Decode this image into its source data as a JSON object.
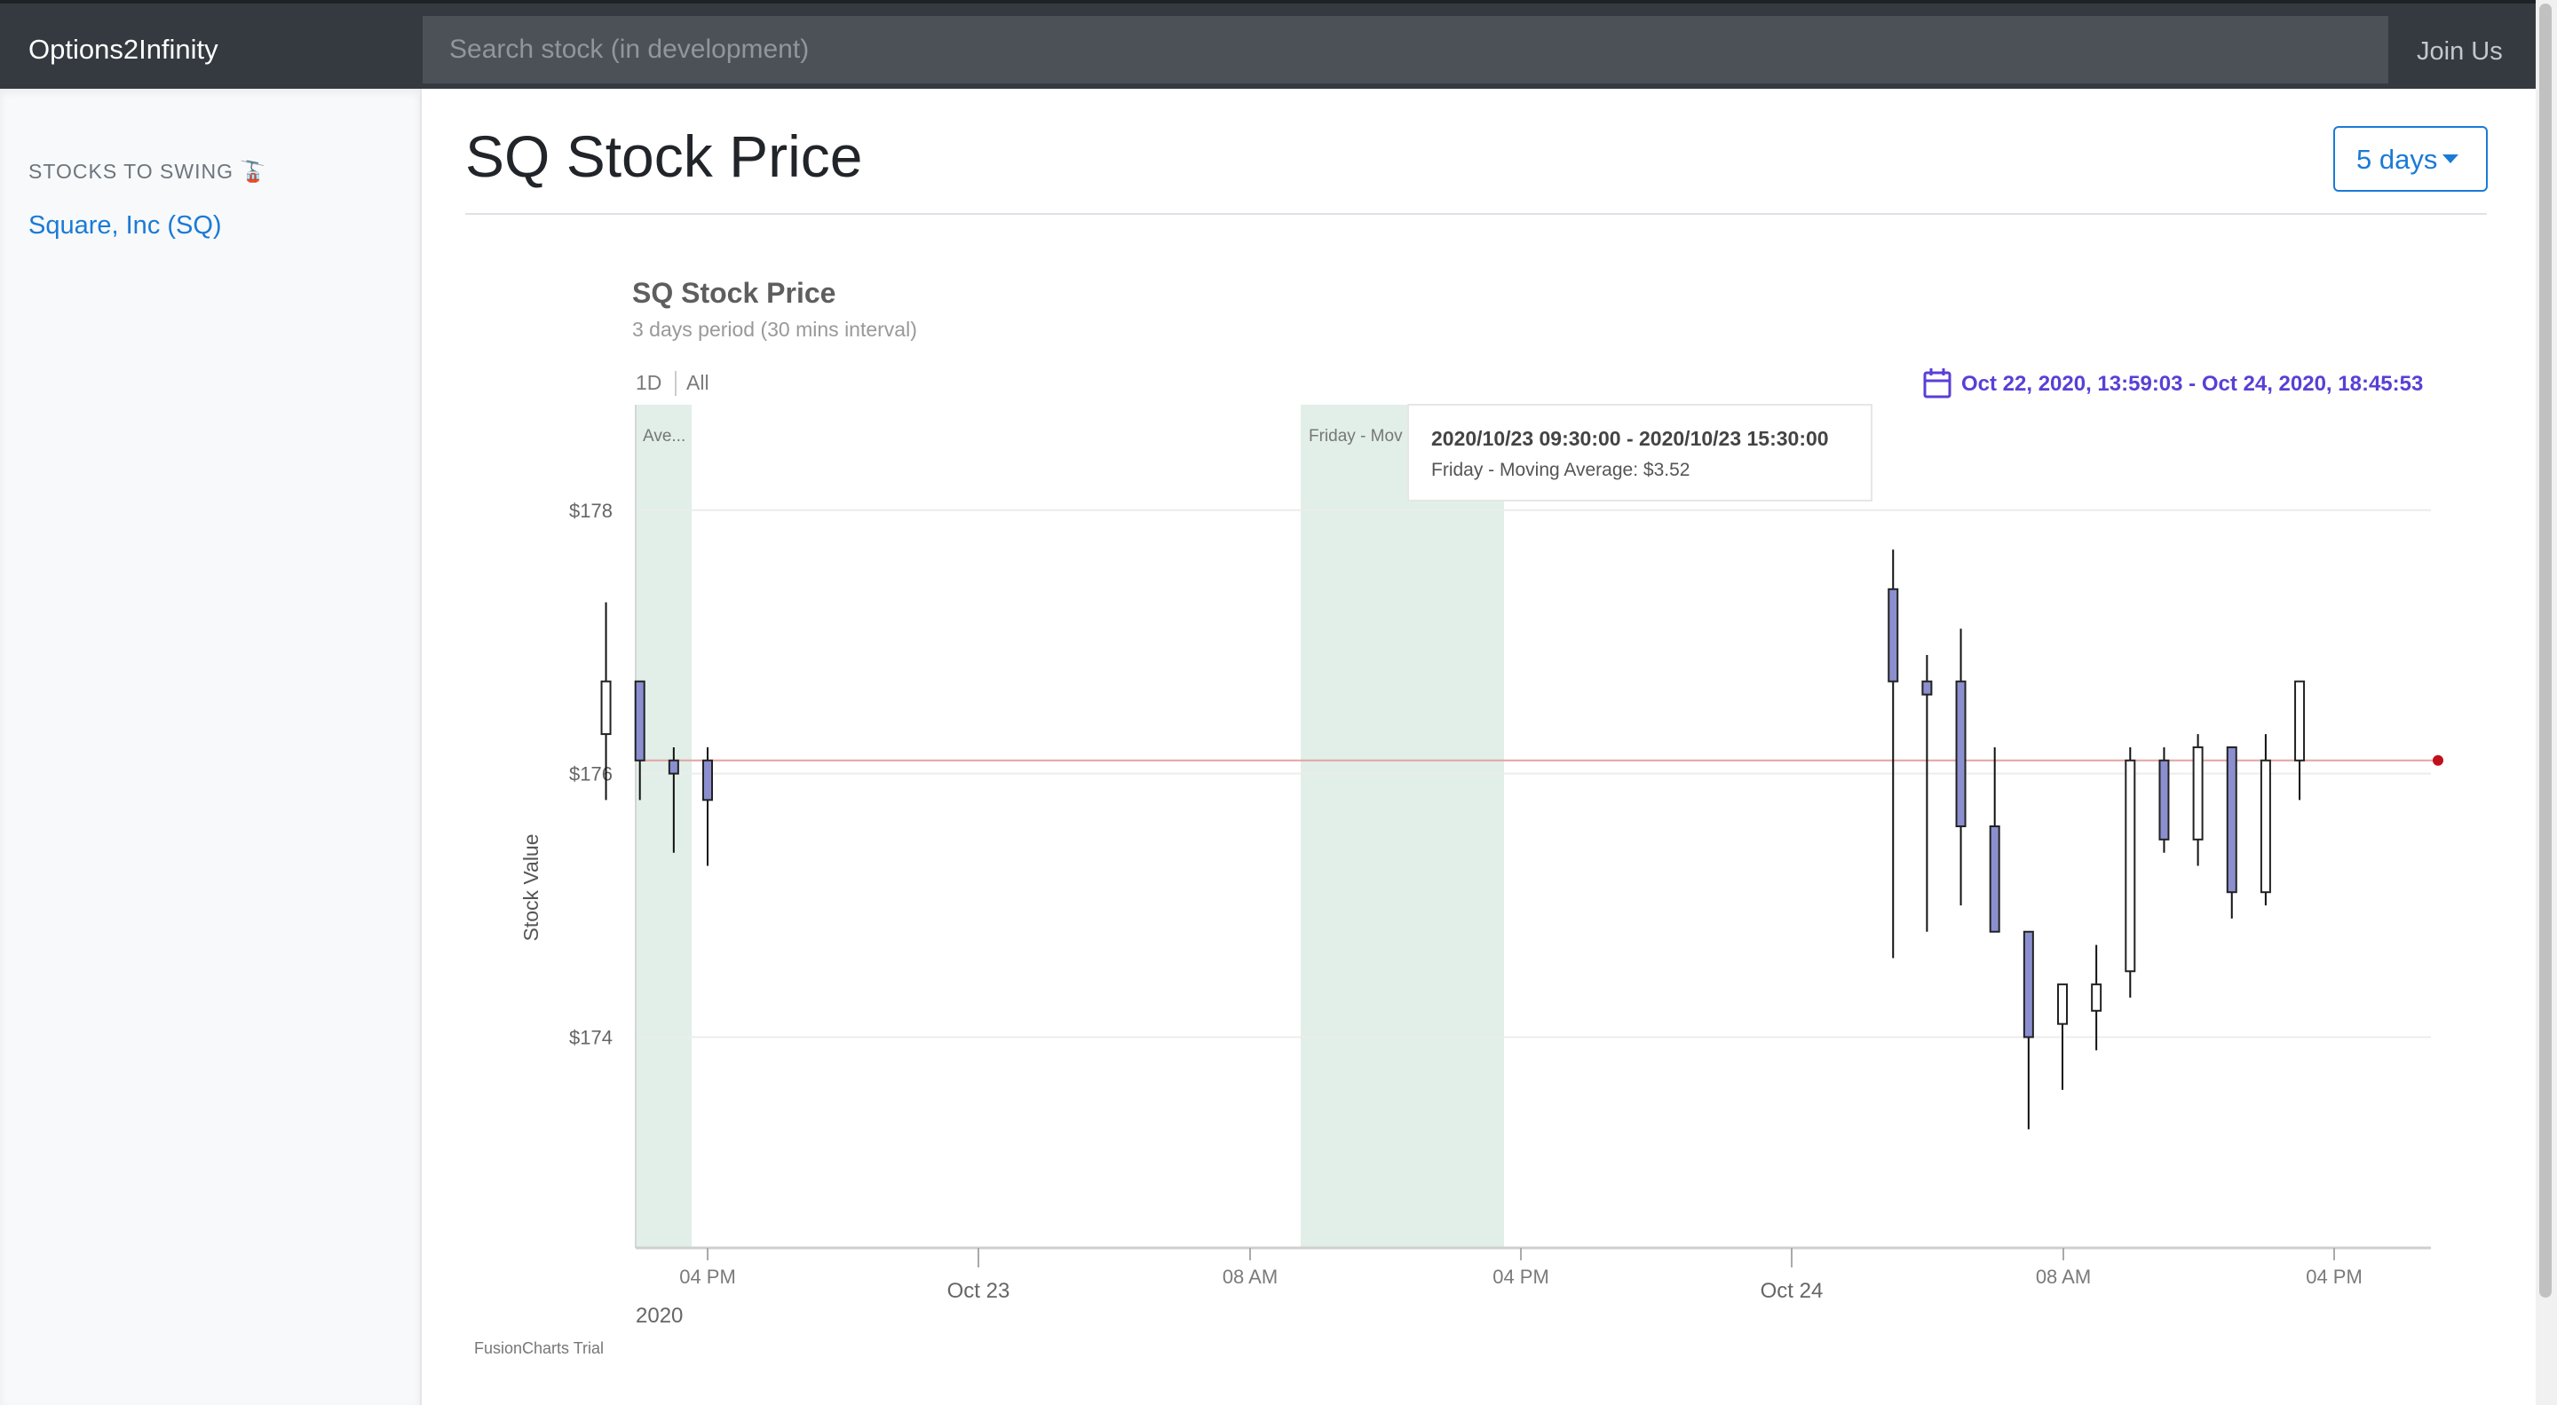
{
  "navbar": {
    "brand": "Options2Infinity",
    "search_placeholder": "Search stock (in development)",
    "join_label": "Join Us"
  },
  "sidebar": {
    "heading": "STOCKS TO SWING 🚡",
    "items": [
      {
        "label": "Square, Inc (SQ)"
      }
    ]
  },
  "main": {
    "title": "SQ Stock Price",
    "range_button": "5 days"
  },
  "chart": {
    "title": "SQ Stock Price",
    "subtitle": "3 days period (30 mins interval)",
    "period_buttons": [
      "1D",
      "All"
    ],
    "date_range": "Oct 22, 2020, 13:59:03 - Oct 24, 2020, 18:45:53",
    "ylabel": "Stock Value",
    "x_tick_labels": [
      "04 PM",
      "Oct 23",
      "08 AM",
      "04 PM",
      "Oct 24",
      "08 AM",
      "04 PM"
    ],
    "year_label": "2020",
    "band_labels": [
      "Ave...",
      "Friday - Mov"
    ],
    "tooltip": {
      "title": "2020/10/23 09:30:00 - 2020/10/23 15:30:00",
      "body": "Friday - Moving Average: $3.52"
    },
    "watermark": "FusionCharts Trial",
    "colors": {
      "down": "#8b8fd0",
      "up": "#ffffff",
      "band": "#e1efe8",
      "line": "#e2a3a3",
      "marker": "#c0111b",
      "accent": "#5a3fd6"
    }
  },
  "chart_data": {
    "type": "candlestick",
    "title": "SQ Stock Price",
    "subtitle": "3 days period (30 mins interval)",
    "ylabel": "Stock Value",
    "ylim": [
      172.4,
      178.8
    ],
    "y_ticks": [
      "$174",
      "$176",
      "$178"
    ],
    "y_tick_values": [
      174,
      176,
      178
    ],
    "reference_line": 176.1,
    "candles": [
      {
        "time": "2020-10-22 14:30",
        "open": 176.3,
        "high": 177.3,
        "low": 175.8,
        "close": 176.7
      },
      {
        "time": "2020-10-22 15:00",
        "open": 176.7,
        "high": 176.7,
        "low": 175.8,
        "close": 176.1
      },
      {
        "time": "2020-10-22 15:30",
        "open": 176.1,
        "high": 176.2,
        "low": 175.4,
        "close": 176.0
      },
      {
        "time": "2020-10-22 16:00",
        "open": 176.1,
        "high": 176.2,
        "low": 175.3,
        "close": 175.8
      },
      {
        "time": "2020-10-23 09:30",
        "open": 177.4,
        "high": 177.7,
        "low": 174.6,
        "close": 176.7
      },
      {
        "time": "2020-10-23 10:00",
        "open": 176.7,
        "high": 176.9,
        "low": 174.8,
        "close": 176.6
      },
      {
        "time": "2020-10-23 10:30",
        "open": 176.7,
        "high": 177.1,
        "low": 175.0,
        "close": 175.6
      },
      {
        "time": "2020-10-23 11:00",
        "open": 175.6,
        "high": 176.2,
        "low": 174.8,
        "close": 174.8
      },
      {
        "time": "2020-10-23 11:30",
        "open": 174.8,
        "high": 174.8,
        "low": 173.3,
        "close": 174.0
      },
      {
        "time": "2020-10-23 12:00",
        "open": 174.1,
        "high": 174.4,
        "low": 173.6,
        "close": 174.4
      },
      {
        "time": "2020-10-23 12:30",
        "open": 174.2,
        "high": 174.7,
        "low": 173.9,
        "close": 174.4
      },
      {
        "time": "2020-10-23 13:00",
        "open": 174.5,
        "high": 176.2,
        "low": 174.3,
        "close": 176.1
      },
      {
        "time": "2020-10-23 13:30",
        "open": 176.1,
        "high": 176.2,
        "low": 175.4,
        "close": 175.5
      },
      {
        "time": "2020-10-23 14:00",
        "open": 175.5,
        "high": 176.3,
        "low": 175.3,
        "close": 176.2
      },
      {
        "time": "2020-10-23 14:30",
        "open": 176.2,
        "high": 176.2,
        "low": 174.9,
        "close": 175.1
      },
      {
        "time": "2020-10-23 15:00",
        "open": 175.1,
        "high": 176.3,
        "low": 175.0,
        "close": 176.1
      },
      {
        "time": "2020-10-23 15:30",
        "open": 176.1,
        "high": 176.6,
        "low": 175.8,
        "close": 176.7
      }
    ]
  }
}
